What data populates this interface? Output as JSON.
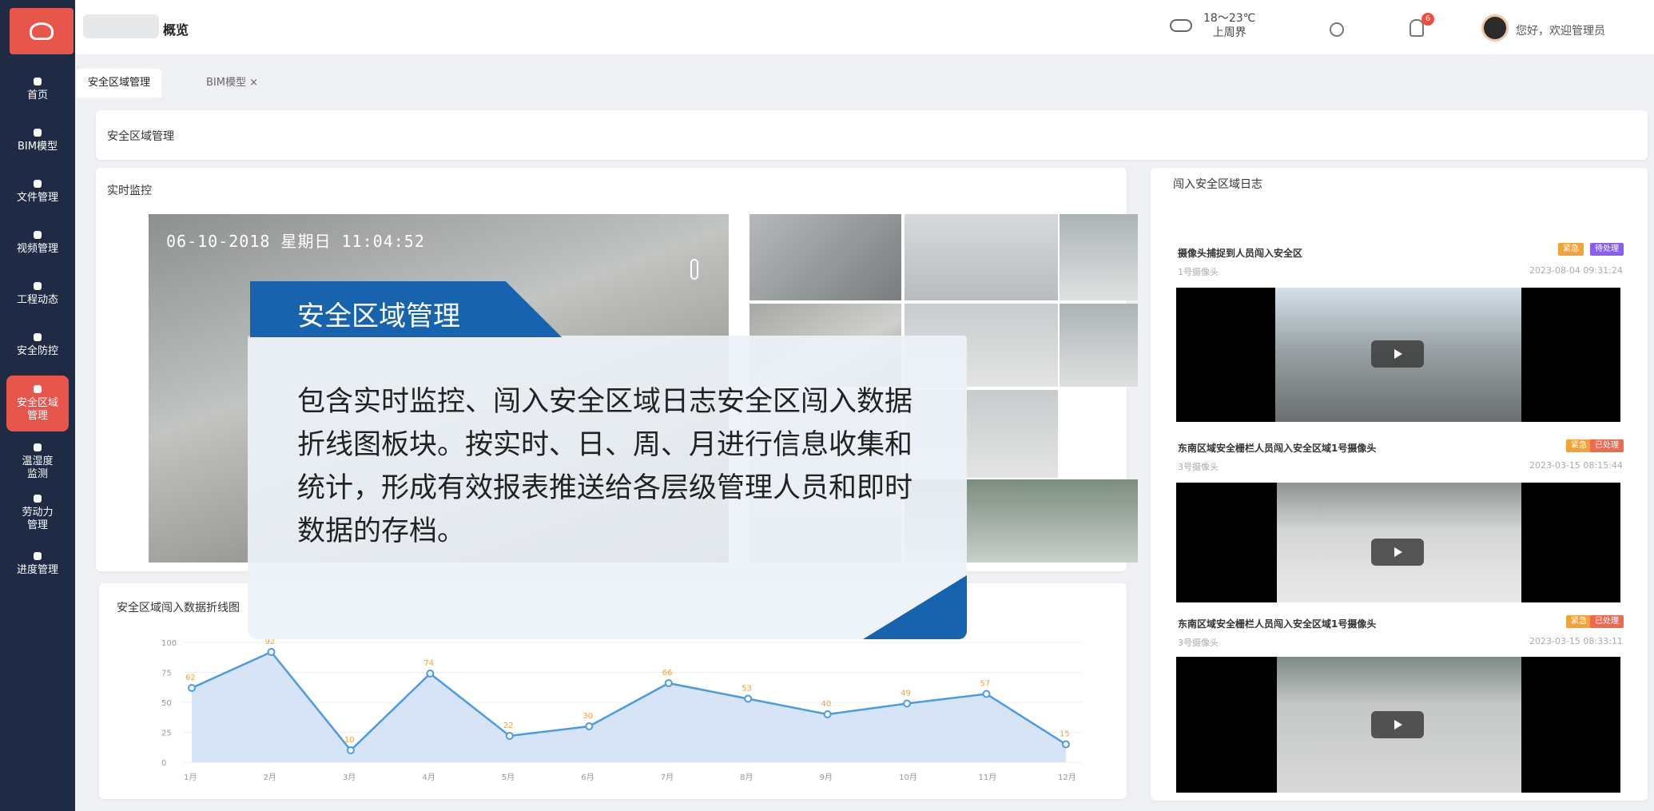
{
  "header": {
    "page_title": "概览",
    "weather_temp": "18～23℃",
    "weather_time": "上周界",
    "notification_count": "6",
    "greeting": "您好，欢迎管理员"
  },
  "sidebar": {
    "items": [
      {
        "label": "首页"
      },
      {
        "label": "BIM模型"
      },
      {
        "label": "文件管理"
      },
      {
        "label": "视频管理"
      },
      {
        "label": "工程动态"
      },
      {
        "label": "安全防控"
      },
      {
        "label": "安全区域管理"
      },
      {
        "label": "温湿度监测"
      },
      {
        "label": "劳动力管理"
      },
      {
        "label": "进度管理"
      }
    ]
  },
  "tabs": [
    {
      "label": "安全区域管理"
    },
    {
      "label": "BIM模型 ×"
    }
  ],
  "breadcrumb": "安全区域管理",
  "monitor": {
    "title": "实时监控",
    "timestamp": "06-10-2018 星期日 11:04:52"
  },
  "overlay": {
    "heading": "安全区域管理",
    "body": "包含实时监控、闯入安全区域日志安全区闯入数据折线图板块。按实时、日、周、月进行信息收集和统计，形成有效报表推送给各层级管理人员和即时数据的存档。"
  },
  "log": {
    "title": "闯入安全区域日志",
    "entries": [
      {
        "title": "摄像头捕捉到人员闯入安全区",
        "sub": "1号摄像头",
        "time": "2023-08-04 09:31:24",
        "badges": [
          "紧急",
          "待处理"
        ]
      },
      {
        "title": "东南区域安全栅栏人员闯入安全区域1号摄像头",
        "sub": "3号摄像头",
        "time": "2023-03-15 08:15:44",
        "badges": [
          "紧急",
          "已处理"
        ]
      },
      {
        "title": "东南区域安全栅栏人员闯入安全区域1号摄像头",
        "sub": "3号摄像头",
        "time": "2023-03-15 08:33:11",
        "badges": [
          "紧急",
          "已处理"
        ]
      }
    ]
  },
  "chart_data": {
    "type": "area",
    "title": "安全区域闯入数据折线图",
    "categories": [
      "1月",
      "2月",
      "3月",
      "4月",
      "5月",
      "6月",
      "7月",
      "8月",
      "9月",
      "10月",
      "11月",
      "12月"
    ],
    "values": [
      62,
      92,
      10,
      74,
      22,
      30,
      66,
      53,
      40,
      49,
      57,
      15
    ],
    "ylim": [
      0,
      100
    ],
    "yticks": [
      0,
      25,
      50,
      75,
      100
    ],
    "line_color": "#4a9be3",
    "fill_color": "#d6e4f6"
  }
}
